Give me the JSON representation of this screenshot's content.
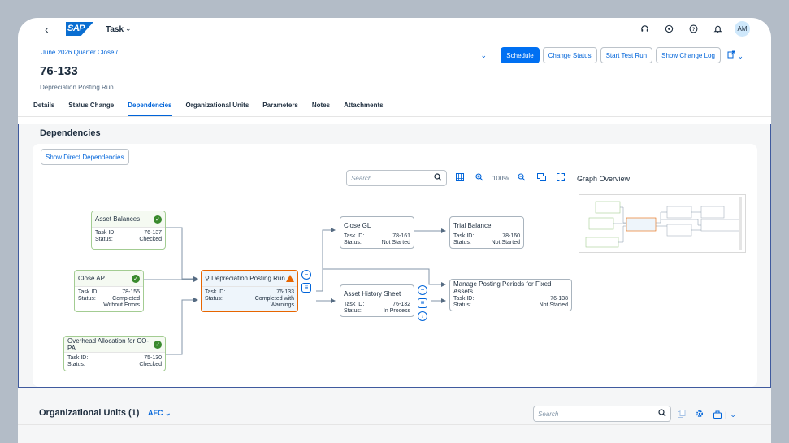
{
  "shell": {
    "back_icon": "‹",
    "logo": "SAP",
    "app_title": "Task",
    "app_menu_icon": "chevron-down",
    "icons": [
      "headset-icon",
      "support-icon",
      "help-icon",
      "bell-icon"
    ],
    "avatar": "AM"
  },
  "header": {
    "breadcrumb": "June 2026 Quarter Close /",
    "title": "76-133",
    "subtitle": "Depreciation Posting Run",
    "actions": {
      "schedule": "Schedule",
      "change_status": "Change Status",
      "start_test_run": "Start Test Run",
      "show_change_log": "Show Change Log"
    }
  },
  "tabs": [
    "Details",
    "Status Change",
    "Dependencies",
    "Organizational Units",
    "Parameters",
    "Notes",
    "Attachments"
  ],
  "active_tab": "Dependencies",
  "dependencies": {
    "title": "Dependencies",
    "show_direct_button": "Show Direct Dependencies",
    "search_placeholder": "Search",
    "zoom": "100%",
    "overview_title": "Graph Overview",
    "nodes": {
      "asset_balances": {
        "title": "Asset Balances",
        "task_id_label": "Task ID:",
        "task_id": "76-137",
        "status_label": "Status:",
        "status": "Checked"
      },
      "close_ap": {
        "title": "Close AP",
        "task_id_label": "Task ID:",
        "task_id": "78-155",
        "status_label": "Status:",
        "status_1": "Completed",
        "status_2": "Without Errors"
      },
      "overhead": {
        "title": "Overhead Allocation for CO-PA",
        "task_id_label": "Task ID:",
        "task_id": "75-130",
        "status_label": "Status:",
        "status": "Checked"
      },
      "depreciation": {
        "title": "Depreciation Posting Run",
        "task_id_label": "Task ID:",
        "task_id": "76-133",
        "status_label": "Status:",
        "status_1": "Completed with",
        "status_2": "Warnings"
      },
      "close_gl": {
        "title": "Close GL",
        "task_id_label": "Task ID:",
        "task_id": "78-161",
        "status_label": "Status:",
        "status": "Not Started"
      },
      "trial_balance": {
        "title": "Trial Balance",
        "task_id_label": "Task ID:",
        "task_id": "78-160",
        "status_label": "Status:",
        "status": "Not Started"
      },
      "asset_history": {
        "title": "Asset History Sheet",
        "task_id_label": "Task ID:",
        "task_id": "76-132",
        "status_label": "Status:",
        "status": "In Process"
      },
      "manage_periods": {
        "title": "Manage Posting Periods for Fixed Assets",
        "task_id_label": "Task ID:",
        "task_id": "76-138",
        "status_label": "Status:",
        "status": "Not Started"
      }
    }
  },
  "org_units": {
    "title": "Organizational Units (1)",
    "selector": "AFC",
    "search_placeholder": "Search"
  },
  "colors": {
    "brand_blue": "#0070f2",
    "link_blue": "#0064d9",
    "success_green": "#3a8a2e",
    "warning_orange": "#e76500"
  }
}
